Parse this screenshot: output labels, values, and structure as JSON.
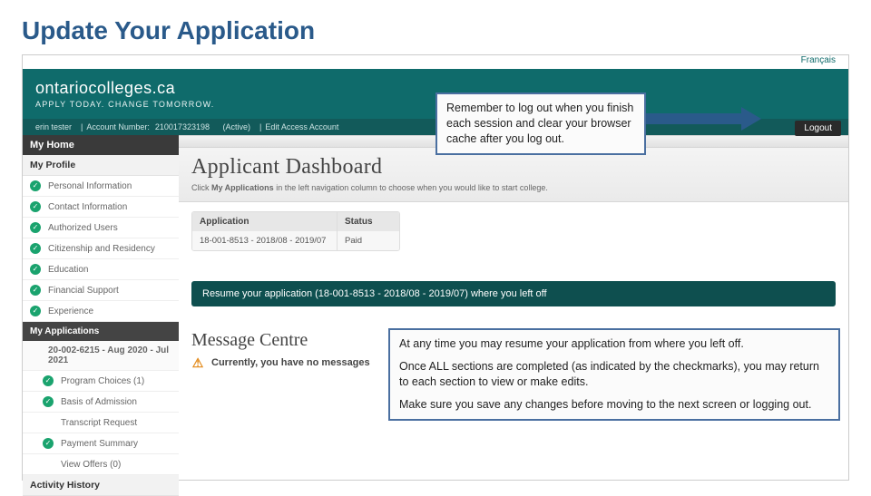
{
  "slide_title": "Update Your Application",
  "lang_link": "Français",
  "logo": {
    "main": "ontariocolleges.ca",
    "sub": "APPLY TODAY. CHANGE TOMORROW."
  },
  "userbar": {
    "name": "erin tester",
    "account_label": "Account Number:",
    "account": "210017323198",
    "status": "(Active)",
    "edit": "Edit Access Account"
  },
  "logout": "Logout",
  "sidebar": {
    "myhome": "My Home",
    "myprofile": "My Profile",
    "items": [
      {
        "label": "Personal Information",
        "checked": true
      },
      {
        "label": "Contact Information",
        "checked": true
      },
      {
        "label": "Authorized Users",
        "checked": true
      },
      {
        "label": "Citizenship and Residency",
        "checked": true
      },
      {
        "label": "Education",
        "checked": true
      },
      {
        "label": "Financial Support",
        "checked": true
      },
      {
        "label": "Experience",
        "checked": true
      }
    ],
    "myapps": "My Applications",
    "app_row": "20-002-6215 - Aug 2020 - Jul 2021",
    "app_items": [
      {
        "label": "Program Choices (1)",
        "checked": true
      },
      {
        "label": "Basis of Admission",
        "checked": true
      },
      {
        "label": "Transcript Request",
        "checked": false
      },
      {
        "label": "Payment Summary",
        "checked": true
      },
      {
        "label": "View Offers (0)",
        "checked": false
      }
    ],
    "activity": "Activity History"
  },
  "main": {
    "title": "Applicant Dashboard",
    "help_pre": "Click ",
    "help_bold": "My Applications",
    "help_post": " in the left navigation column to choose when you would like to start college.",
    "table": {
      "h1": "Application",
      "h2": "Status",
      "row_app": "18-001-8513 - 2018/08 - 2019/07",
      "row_status": "Paid"
    },
    "resume": "Resume your application (18-001-8513 - 2018/08 - 2019/07) where you left off",
    "msg_title": "Message Centre",
    "msg_text": "Currently, you have no messages"
  },
  "callouts": {
    "c1": "Remember to log out when you finish each session and clear your  browser cache after you log out.",
    "c2a": "At any time you may resume your application from where you left off.",
    "c2b": "Once ALL sections are completed (as indicated by the checkmarks),  you may return to each section to view or make edits.",
    "c2c": "Make sure you save any changes before moving to the next screen or  logging out."
  }
}
